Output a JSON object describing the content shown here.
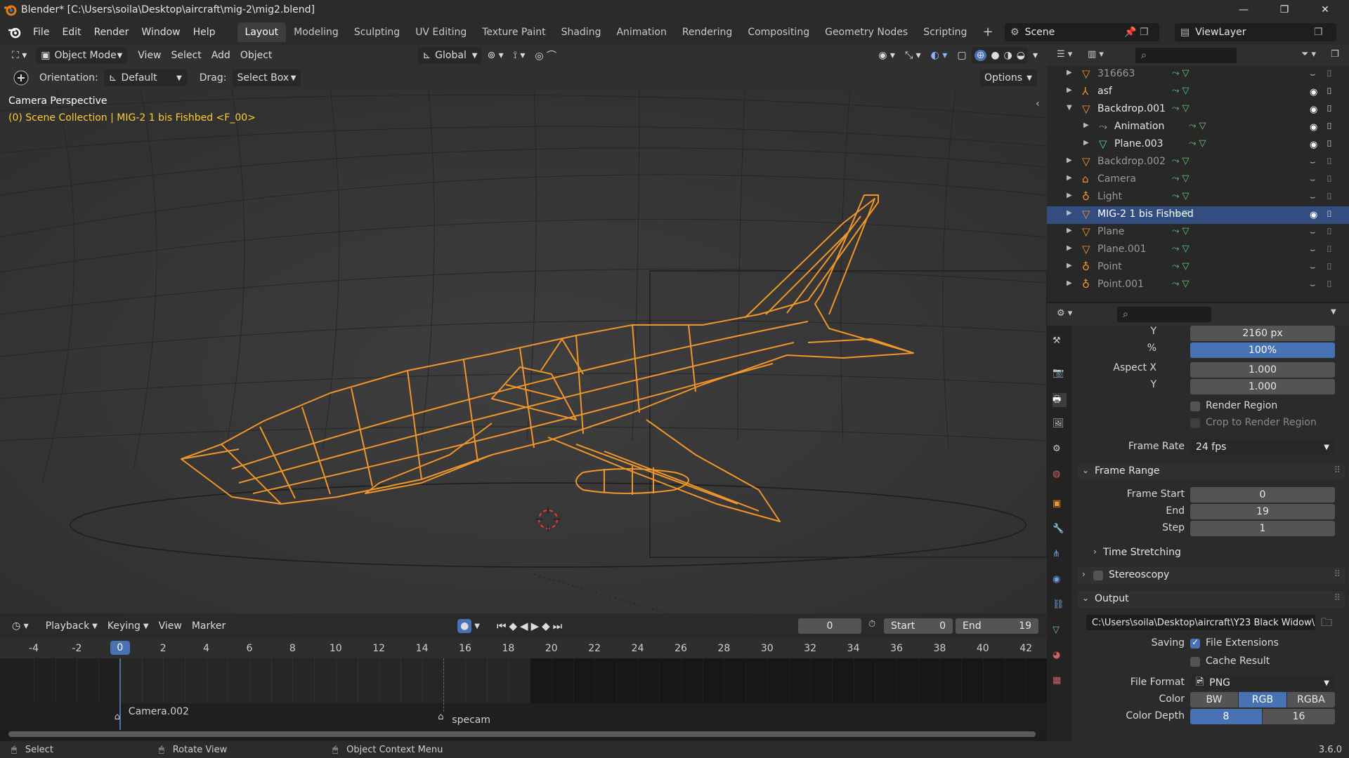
{
  "window": {
    "title": "Blender* [C:\\Users\\soila\\Desktop\\aircraft\\mig-2\\mig2.blend]",
    "minimize": "—",
    "maximize": "❐",
    "close": "✕"
  },
  "menu": [
    "File",
    "Edit",
    "Render",
    "Window",
    "Help"
  ],
  "workspaces": [
    "Layout",
    "Modeling",
    "Sculpting",
    "UV Editing",
    "Texture Paint",
    "Shading",
    "Animation",
    "Rendering",
    "Compositing",
    "Geometry Nodes",
    "Scripting"
  ],
  "active_workspace": "Layout",
  "scene": "Scene",
  "view_layer": "ViewLayer",
  "viewport_header": {
    "mode": "Object Mode",
    "menus": [
      "View",
      "Select",
      "Add",
      "Object"
    ],
    "transform": "Global"
  },
  "tool_settings": {
    "orientation_label": "Orientation:",
    "orientation_value": "Default",
    "drag_label": "Drag:",
    "drag_value": "Select Box",
    "options": "Options"
  },
  "viewport": {
    "title": "Camera Perspective",
    "collection_info": "(0) Scene Collection | MIG-2 1 bis Fishbed <F_00>"
  },
  "outliner": {
    "rows": [
      {
        "name": "316663",
        "indent": 0,
        "expanded": false,
        "selected": false,
        "dim": true
      },
      {
        "name": "asf",
        "indent": 0,
        "expanded": false,
        "selected": false,
        "dim": false
      },
      {
        "name": "Backdrop.001",
        "indent": 0,
        "expanded": true,
        "selected": false,
        "dim": false
      },
      {
        "name": "Animation",
        "indent": 1,
        "expanded": false,
        "selected": false,
        "dim": false
      },
      {
        "name": "Plane.003",
        "indent": 1,
        "expanded": false,
        "selected": false,
        "dim": false
      },
      {
        "name": "Backdrop.002",
        "indent": 0,
        "expanded": false,
        "selected": false,
        "dim": true
      },
      {
        "name": "Camera",
        "indent": 0,
        "expanded": false,
        "selected": false,
        "dim": true
      },
      {
        "name": "Light",
        "indent": 0,
        "expanded": false,
        "selected": false,
        "dim": true
      },
      {
        "name": "MIG-2 1 bis Fishbed",
        "indent": 0,
        "expanded": false,
        "selected": true,
        "dim": false
      },
      {
        "name": "Plane",
        "indent": 0,
        "expanded": false,
        "selected": false,
        "dim": true
      },
      {
        "name": "Plane.001",
        "indent": 0,
        "expanded": false,
        "selected": false,
        "dim": true
      },
      {
        "name": "Point",
        "indent": 0,
        "expanded": false,
        "selected": false,
        "dim": true
      },
      {
        "name": "Point.001",
        "indent": 0,
        "expanded": false,
        "selected": false,
        "dim": true
      }
    ]
  },
  "properties": {
    "res_y_label": "Y",
    "res_y_value": "2160 px",
    "percent_label": "%",
    "percent_value": "100%",
    "percent_fraction": 1.0,
    "aspect_x_label": "Aspect X",
    "aspect_x_value": "1.000",
    "aspect_y_label": "Y",
    "aspect_y_value": "1.000",
    "render_region": "Render Region",
    "crop_region": "Crop to Render Region",
    "frame_rate_label": "Frame Rate",
    "frame_rate_value": "24 fps",
    "frame_range_title": "Frame Range",
    "frame_start_label": "Frame Start",
    "frame_start_value": "0",
    "end_label": "End",
    "end_value": "19",
    "step_label": "Step",
    "step_value": "1",
    "time_stretching": "Time Stretching",
    "stereoscopy": "Stereoscopy",
    "output_title": "Output",
    "output_path": "C:\\Users\\soila\\Desktop\\aircraft\\Y23 Black Widow\\",
    "saving_label": "Saving",
    "file_extensions": "File Extensions",
    "cache_result": "Cache Result",
    "file_format_label": "File Format",
    "file_format_value": "PNG",
    "color_label": "Color",
    "color_options": [
      "BW",
      "RGB",
      "RGBA"
    ],
    "color_selected": "RGB",
    "color_depth_label": "Color Depth",
    "color_depth_options": [
      "8",
      "16"
    ],
    "color_depth_selected": "8"
  },
  "timeline": {
    "menus": [
      "Playback",
      "Keying",
      "View",
      "Marker"
    ],
    "current_frame": "0",
    "start_label": "Start",
    "start_value": "0",
    "end_label": "End",
    "end_value": "19",
    "ruler_frames": [
      "-4",
      "-2",
      "0",
      "2",
      "4",
      "6",
      "8",
      "10",
      "12",
      "14",
      "16",
      "18",
      "20",
      "22",
      "24",
      "26",
      "28",
      "30",
      "32",
      "34",
      "36",
      "38",
      "40",
      "42"
    ],
    "playhead_label": "0",
    "markers": [
      {
        "name": "Camera.002",
        "frame": 0
      },
      {
        "name": "specam",
        "frame": 15
      }
    ]
  },
  "statusbar": {
    "select": "Select",
    "rotate": "Rotate View",
    "context": "Object Context Menu",
    "version": "3.6.0"
  },
  "colors": {
    "accent": "#4772b3",
    "wireframe": "#f0962a",
    "collection_text": "#ffcc33",
    "outliner_selected": "#334d80"
  }
}
